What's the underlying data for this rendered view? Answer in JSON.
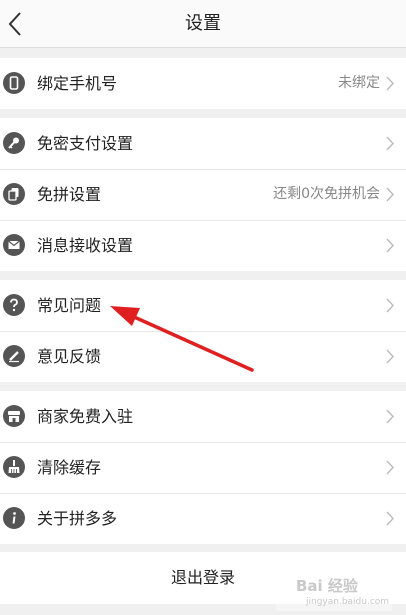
{
  "header": {
    "title": "设置",
    "back_icon": "chevron-left-icon"
  },
  "groups": [
    {
      "items": [
        {
          "label": "绑定手机号",
          "value": "未绑定",
          "icon": "phone-icon"
        }
      ]
    },
    {
      "items": [
        {
          "label": "免密支付设置",
          "icon": "key-icon"
        },
        {
          "label": "免拼设置",
          "value": "还剩0次免拼机会",
          "icon": "cards-icon"
        },
        {
          "label": "消息接收设置",
          "icon": "envelope-icon"
        }
      ]
    },
    {
      "items": [
        {
          "label": "常见问题",
          "icon": "question-icon"
        },
        {
          "label": "意见反馈",
          "icon": "pencil-icon"
        }
      ]
    },
    {
      "items": [
        {
          "label": "商家免费入驻",
          "icon": "store-icon"
        },
        {
          "label": "清除缓存",
          "icon": "broom-icon"
        },
        {
          "label": "关于拼多多",
          "icon": "info-icon"
        }
      ]
    }
  ],
  "logout": {
    "label": "退出登录"
  },
  "watermark": {
    "text": "Bai 经验",
    "url": "jingyan.baidu.com"
  },
  "annotation": {
    "arrow_color": "#e02020",
    "points_to": "常见问题"
  },
  "colors": {
    "page_bg": "#f0f0f0",
    "icon": "#555555",
    "secondary_text": "#888888"
  }
}
